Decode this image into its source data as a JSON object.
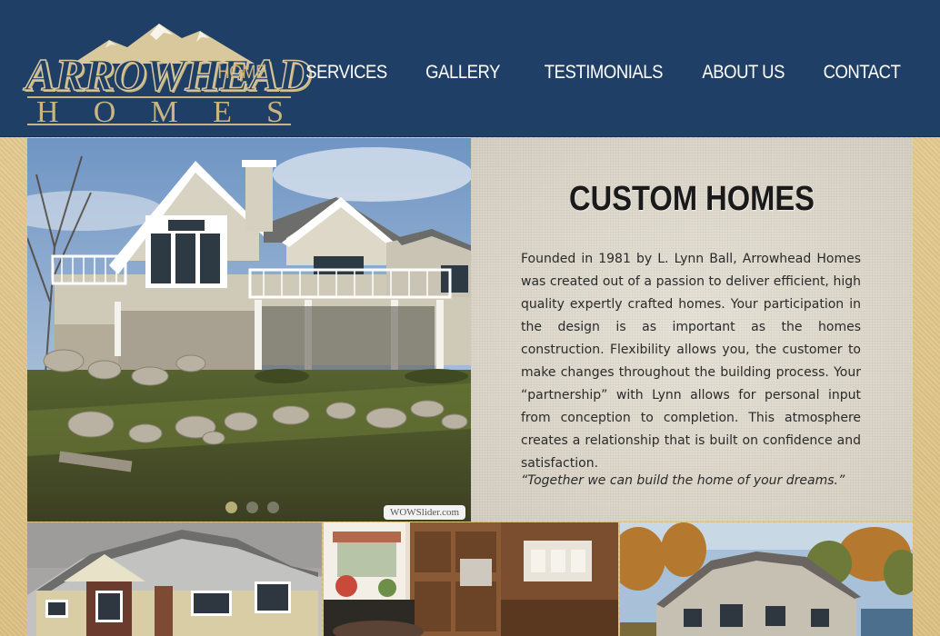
{
  "brand": {
    "logo_line1": "ARROWHEAD",
    "logo_line2_letters": [
      "H",
      "O",
      "M",
      "E",
      "S"
    ],
    "colors": {
      "navy": "#1f3f66",
      "gold": "#c9b582",
      "white": "#ffffff"
    }
  },
  "nav": {
    "items": [
      {
        "label": "HOME",
        "active": true
      },
      {
        "label": "SERVICES",
        "active": false
      },
      {
        "label": "GALLERY",
        "active": false
      },
      {
        "label": "TESTIMONIALS",
        "active": false
      },
      {
        "label": "ABOUT US",
        "active": false
      },
      {
        "label": "CONTACT",
        "active": false
      }
    ]
  },
  "slider": {
    "dot_count": 3,
    "active_dot": 1,
    "badge": "WOWSlider.com"
  },
  "panel": {
    "title": "CUSTOM HOMES",
    "body": "Founded in 1981 by L. Lynn Ball, Arrowhead Homes was created out of a passion to deliver efficient, high quality expertly crafted homes. Your participation in the design is as important as the homes construction. Flexibility allows you, the customer to make changes throughout the building process. Your “partnership” with Lynn allows for personal input from conception to completion. This atmosphere creates a relationship that is built on confidence and satisfaction.",
    "quote": "“Together we can build the home of your dreams.”"
  }
}
